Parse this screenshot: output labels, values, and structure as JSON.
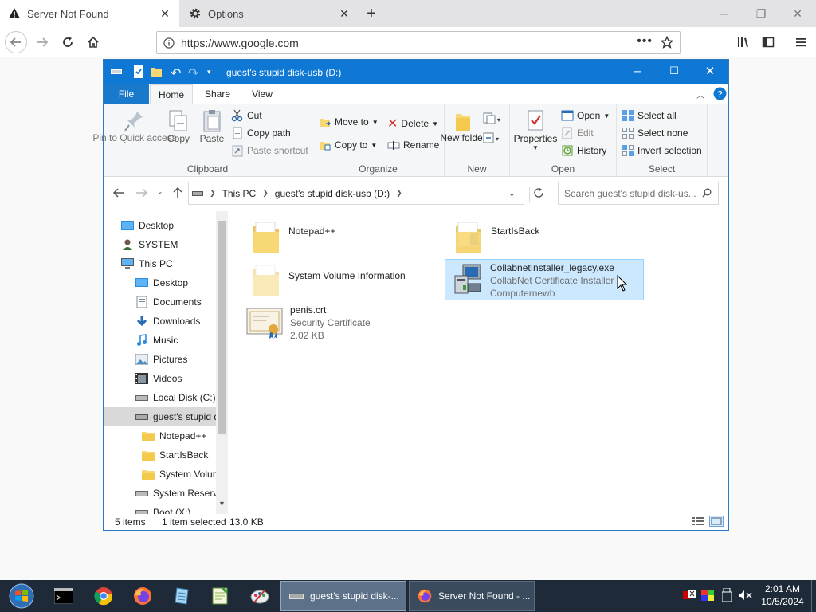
{
  "browser": {
    "tabs": [
      {
        "label": "Server Not Found",
        "active": true
      },
      {
        "label": "Options",
        "active": false
      }
    ],
    "url": "https://www.google.com"
  },
  "explorer": {
    "title": "guest's stupid disk-usb (D:)",
    "ribbon_tabs": [
      "File",
      "Home",
      "Share",
      "View"
    ],
    "clipboard": {
      "pin": "Pin to Quick access",
      "copy": "Copy",
      "paste": "Paste",
      "cut": "Cut",
      "copy_path": "Copy path",
      "paste_shortcut": "Paste shortcut",
      "label": "Clipboard"
    },
    "organize": {
      "move_to": "Move to",
      "copy_to": "Copy to",
      "delete": "Delete",
      "rename": "Rename",
      "label": "Organize"
    },
    "new": {
      "new_folder": "New folder",
      "label": "New"
    },
    "open": {
      "properties": "Properties",
      "open": "Open",
      "edit": "Edit",
      "history": "History",
      "label": "Open"
    },
    "select": {
      "select_all": "Select all",
      "select_none": "Select none",
      "invert": "Invert selection",
      "label": "Select"
    },
    "breadcrumb": [
      "This PC",
      "guest's stupid disk-usb (D:)"
    ],
    "search_placeholder": "Search guest's stupid disk-us...",
    "nav_items": [
      {
        "label": "Desktop",
        "icon": "desktop-icon",
        "indent": 0
      },
      {
        "label": "SYSTEM",
        "icon": "user-icon",
        "indent": 0
      },
      {
        "label": "This PC",
        "icon": "computer-icon",
        "indent": 0
      },
      {
        "label": "Desktop",
        "icon": "desktop-icon",
        "indent": 1
      },
      {
        "label": "Documents",
        "icon": "documents-icon",
        "indent": 1
      },
      {
        "label": "Downloads",
        "icon": "download-icon",
        "indent": 1
      },
      {
        "label": "Music",
        "icon": "music-icon",
        "indent": 1
      },
      {
        "label": "Pictures",
        "icon": "pictures-icon",
        "indent": 1
      },
      {
        "label": "Videos",
        "icon": "videos-icon",
        "indent": 1
      },
      {
        "label": "Local Disk (C:)",
        "icon": "drive-icon",
        "indent": 1
      },
      {
        "label": "guest's stupid disk-usb (D:)",
        "icon": "usb-drive-icon",
        "indent": 1,
        "selected": true
      },
      {
        "label": "Notepad++",
        "icon": "folder-icon",
        "indent": 2
      },
      {
        "label": "StartIsBack",
        "icon": "folder-icon",
        "indent": 2
      },
      {
        "label": "System Volume Information",
        "icon": "folder-icon",
        "indent": 2
      },
      {
        "label": "System Reserved",
        "icon": "drive-icon",
        "indent": 1
      },
      {
        "label": "Boot (X:)",
        "icon": "drive-icon",
        "indent": 1
      }
    ],
    "files": [
      {
        "name": "Notepad++",
        "icon": "folder-icon"
      },
      {
        "name": "StartIsBack",
        "icon": "folder-icon"
      },
      {
        "name": "System Volume Information",
        "icon": "folder-icon"
      },
      {
        "name": "CollabnetInstaller_legacy.exe",
        "desc": "CollabNet Certificate Installer",
        "company": "Computernewb",
        "icon": "installer-icon",
        "selected": true
      },
      {
        "name": "penis.crt",
        "desc": "Security Certificate",
        "size": "2.02 KB",
        "icon": "certificate-icon"
      }
    ],
    "status": {
      "items": "5 items",
      "selected": "1 item selected",
      "size": "13.0 KB"
    }
  },
  "taskbar": {
    "windows": [
      {
        "label": "guest's stupid disk-...",
        "active": true
      },
      {
        "label": "Server Not Found - ...",
        "active": false
      }
    ],
    "time": "2:01 AM",
    "date": "10/5/2024"
  },
  "colors": {
    "title_blue": "#0e78d4",
    "file_tab": "#1979ca",
    "selection": "#cce8ff",
    "selection_border": "#99d1ff",
    "taskbar": "#1e2a38"
  }
}
